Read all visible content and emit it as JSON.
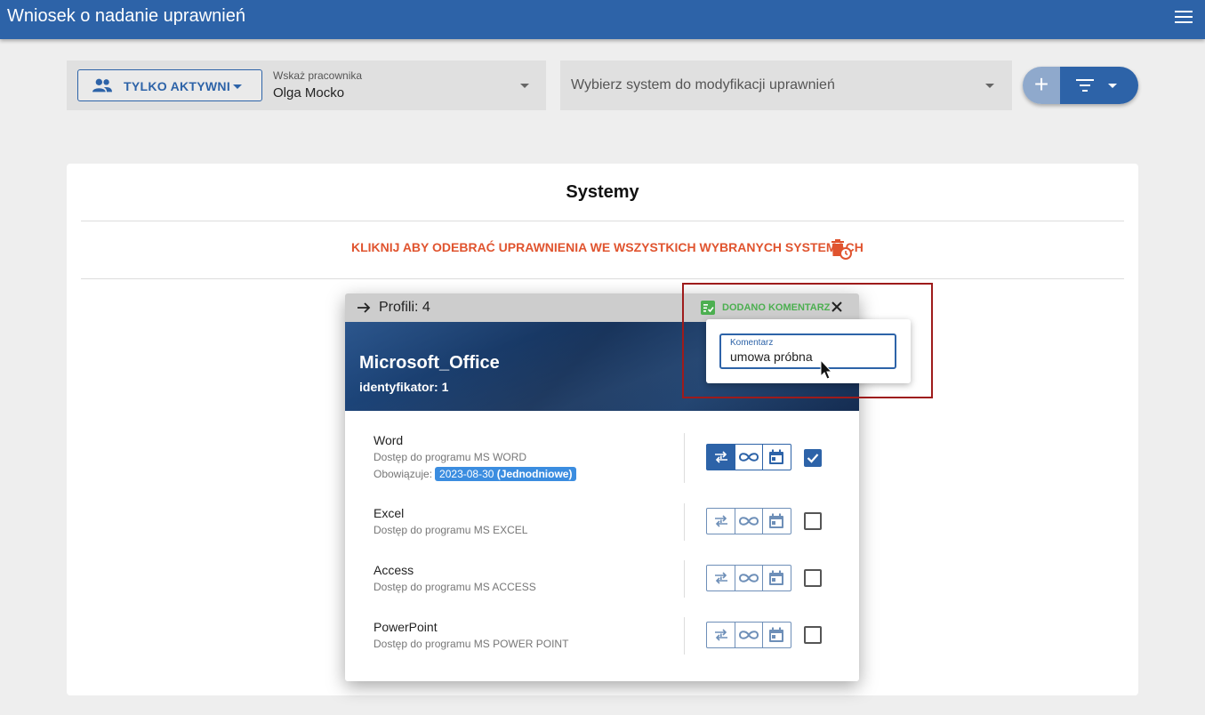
{
  "app": {
    "title": "Wniosek o nadanie uprawnień"
  },
  "toolbar": {
    "active_button": "TYLKO AKTYWNI",
    "employee_label": "Wskaż pracownika",
    "employee_value": "Olga Mocko",
    "system_placeholder": "Wybierz system do modyfikacji uprawnień",
    "add_label": "+"
  },
  "card": {
    "heading": "Systemy",
    "revoke_text": "KLIKNIJ ABY ODEBRAĆ UPRAWNIENIA WE WSZYSTKICH WYBRANYCH SYSTEMACH"
  },
  "dialog": {
    "profiles_label": "Profili: 4",
    "comment_added": "DODANO KOMENTARZ",
    "system_name": "Microsoft_Office",
    "identifier": "identyfikator: 1",
    "profiles": [
      {
        "name": "Word",
        "description": "Dostęp do programu MS WORD",
        "valid_label": "Obowiązuje:",
        "valid_date": "2023-08-30",
        "valid_type": "(Jednodniowe)",
        "checked": true
      },
      {
        "name": "Excel",
        "description": "Dostęp do programu MS EXCEL",
        "checked": false
      },
      {
        "name": "Access",
        "description": "Dostęp do programu MS ACCESS",
        "checked": false
      },
      {
        "name": "PowerPoint",
        "description": "Dostęp do programu MS POWER POINT",
        "checked": false
      }
    ]
  },
  "comment_popup": {
    "label": "Komentarz",
    "value": "umowa próbna"
  },
  "colors": {
    "primary": "#2d63a8",
    "danger": "#e0542f",
    "success": "#4caf50",
    "badge": "#3b8de0",
    "highlight": "#9e1b1b"
  }
}
